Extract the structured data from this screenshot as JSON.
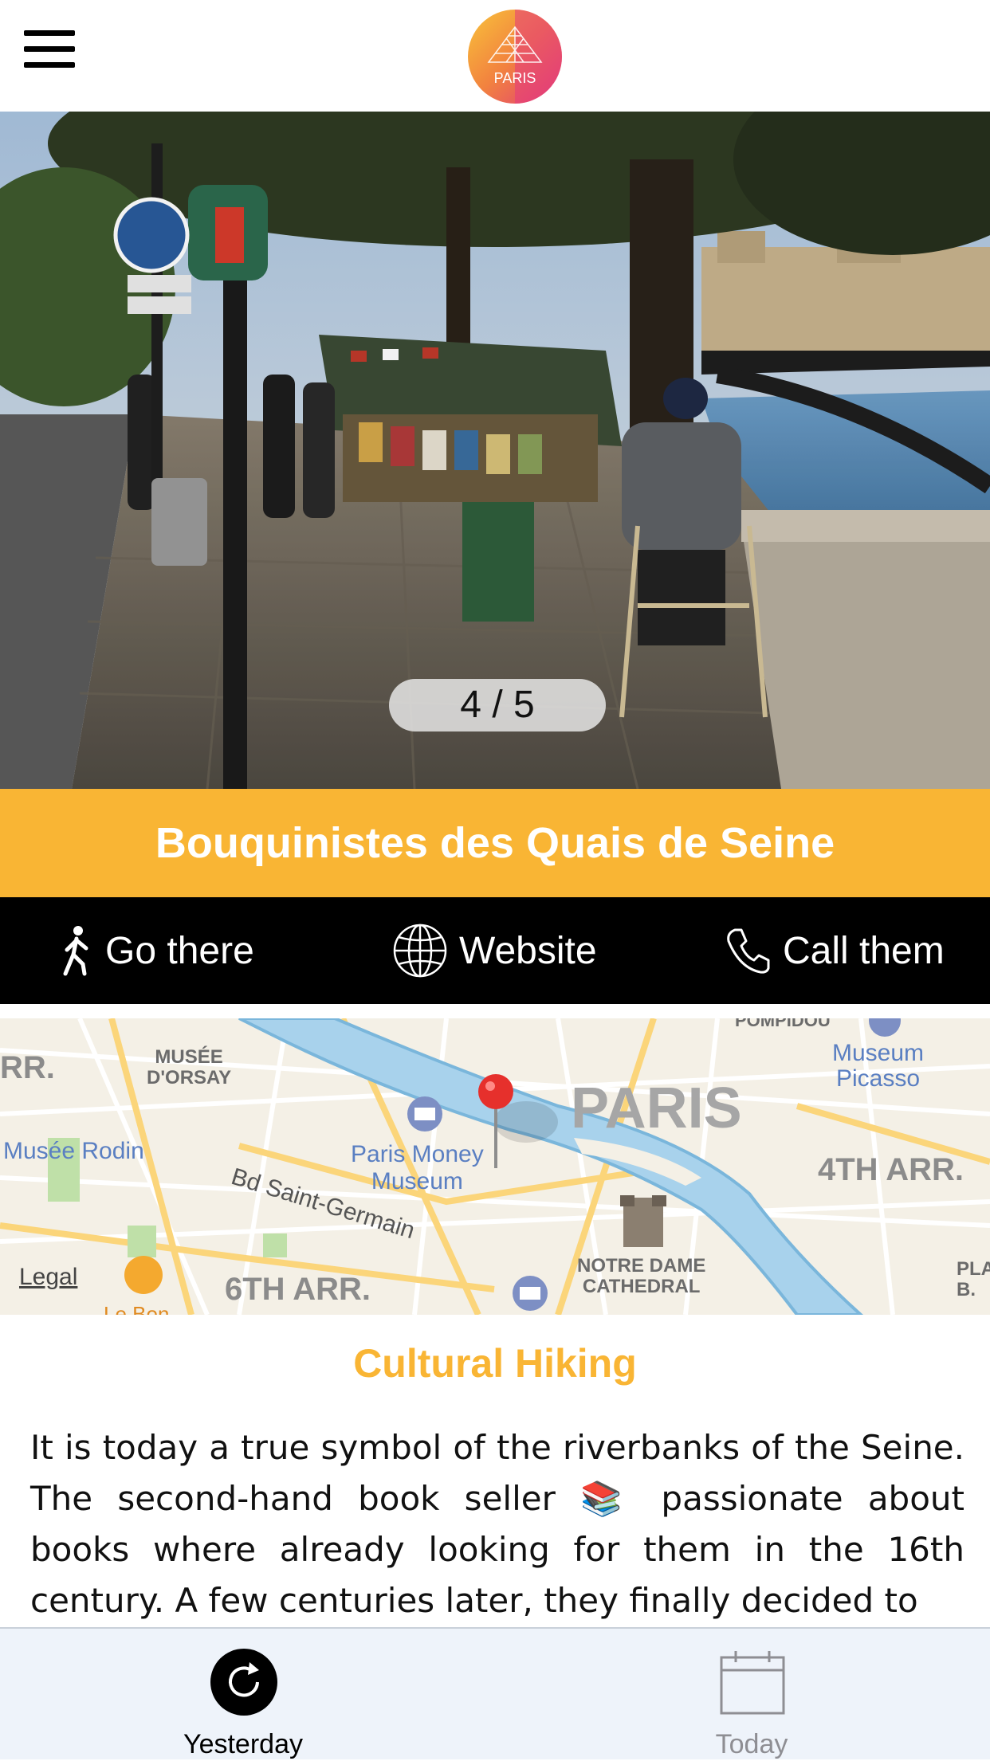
{
  "header": {
    "logo_text": "PARIS",
    "menu_icon": "hamburger-menu-icon"
  },
  "hero": {
    "pager": "4 / 5",
    "current_image": 4,
    "total_images": 5
  },
  "place": {
    "title": "Bouquinistes des Quais de Seine"
  },
  "actions": [
    {
      "label": "Go there",
      "icon": "walking-person-icon"
    },
    {
      "label": "Website",
      "icon": "globe-icon"
    },
    {
      "label": "Call them",
      "icon": "phone-icon"
    }
  ],
  "map": {
    "labels": {
      "musee_orsay": "MUSÉE\nD'ORSAY",
      "pompidou": "POMPIDOU",
      "museum_picasso": "Museum\nPicasso",
      "paris": "PARIS",
      "musee_rodin": "Musée Rodin",
      "paris_money_museum": "Paris Money\nMuseum",
      "fourth_arr": "4TH ARR.",
      "bd_saint_germain": "Bd Saint-Germain",
      "notre_dame": "NOTRE DAME\nCATHEDRAL",
      "sixth_arr": "6TH ARR.",
      "rr": "RR.",
      "pla": "PLA\nB.",
      "le_bon": "Le Bon"
    },
    "legal": "Legal"
  },
  "content": {
    "heading": "Cultural Hiking",
    "text_1": "It is today a true symbol of the riverbanks of the Seine. The second-hand book seller ",
    "emoji": "📚",
    "text_2": " passionate about books where already looking for them in the 16th century. A few centuries later, they finally decided to"
  },
  "tabbar": {
    "tabs": [
      {
        "label": "Yesterday",
        "icon": "refresh-icon",
        "active": true
      },
      {
        "label": "Today",
        "icon": "calendar-icon",
        "active": false
      }
    ]
  },
  "colors": {
    "accent": "#f9b534",
    "action_bar": "#000000",
    "tab_bar_bg": "#eef3fa"
  }
}
